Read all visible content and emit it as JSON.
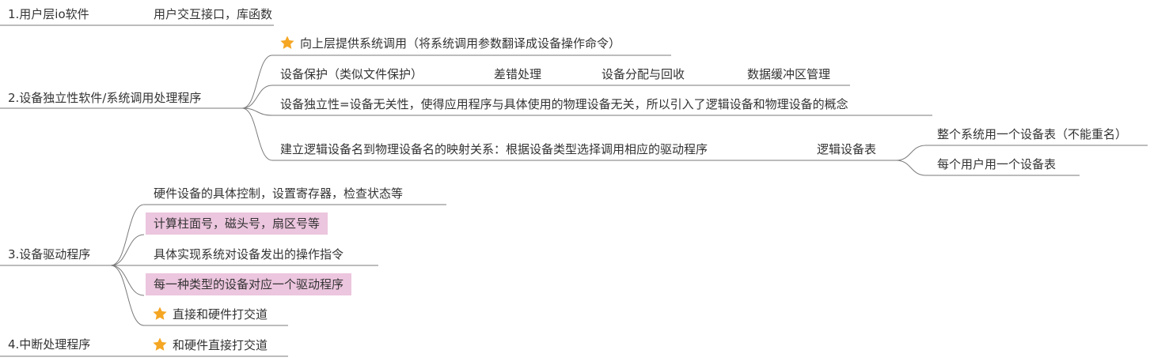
{
  "colors": {
    "line": "#7a7a7a",
    "highlight": "#ecc5de",
    "star": "#f5a623"
  },
  "branches": [
    {
      "label": "1.用户层io软件",
      "children": [
        {
          "label": "用户交互接口，库函数"
        }
      ]
    },
    {
      "label": "2.设备独立性软件/系统调用处理程序",
      "children": [
        {
          "label": "向上层提供系统调用（将系统调用参数翻译成设备操作命令）",
          "icon": "star-icon"
        },
        {
          "labels": [
            "设备保护（类似文件保护）",
            "差错处理",
            "设备分配与回收",
            "数据缓冲区管理"
          ]
        },
        {
          "label": "设备独立性=设备无关性，使得应用程序与具体使用的物理设备无关，所以引入了逻辑设备和物理设备的概念"
        },
        {
          "label": "建立逻辑设备名到物理设备名的映射关系：根据设备类型选择调用相应的驱动程序",
          "child": {
            "label": "逻辑设备表",
            "children": [
              {
                "label": "整个系统用一个设备表（不能重名）"
              },
              {
                "label": "每个用户用一个设备表"
              }
            ]
          }
        }
      ]
    },
    {
      "label": "3.设备驱动程序",
      "children": [
        {
          "label": "硬件设备的具体控制，设置寄存器，检查状态等"
        },
        {
          "label": "计算柱面号，磁头号，扇区号等",
          "highlight": true
        },
        {
          "label": "具体实现系统对设备发出的操作指令"
        },
        {
          "label": "每一种类型的设备对应一个驱动程序",
          "highlight": true
        },
        {
          "label": "直接和硬件打交道",
          "icon": "star-icon"
        }
      ]
    },
    {
      "label": "4.中断处理程序",
      "children": [
        {
          "label": "和硬件直接打交道",
          "icon": "star-icon"
        }
      ]
    }
  ]
}
